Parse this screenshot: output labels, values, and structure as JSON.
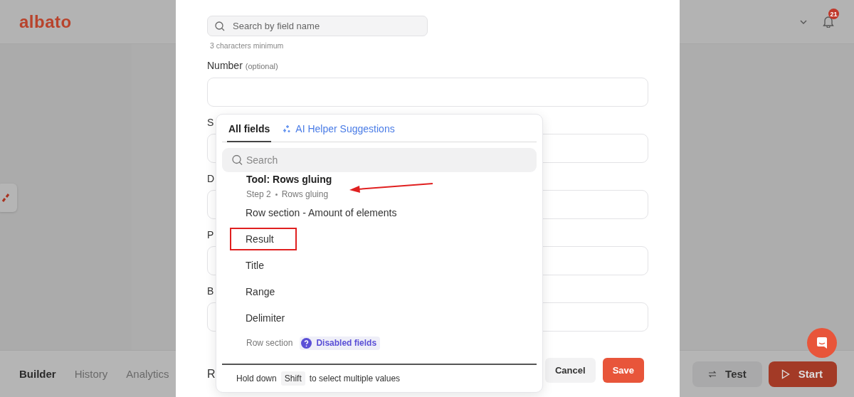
{
  "header": {
    "logo": "albato",
    "notifications": "21"
  },
  "bottom_bar": {
    "tabs": [
      {
        "label": "Builder",
        "selected": true
      },
      {
        "label": "History",
        "selected": false
      },
      {
        "label": "Analytics",
        "selected": false
      }
    ],
    "test_button": "Test",
    "start_button": "Start"
  },
  "modal": {
    "search": {
      "placeholder": "Search by field name",
      "hint": "3 characters minimum"
    },
    "fields": [
      {
        "label": "Number",
        "note": "(optional)"
      },
      {
        "label": "S"
      },
      {
        "label": "D"
      },
      {
        "label": "P"
      },
      {
        "label": "B"
      }
    ],
    "section_heading": "R",
    "cancel_button": "Cancel",
    "save_button": "Save"
  },
  "dropdown": {
    "tabs": [
      {
        "label": "All fields",
        "selected": true,
        "kind": "plain"
      },
      {
        "label": "AI Helper Suggestions",
        "selected": false,
        "kind": "ai"
      }
    ],
    "search": {
      "placeholder": "Search"
    },
    "group": {
      "title": "Tool: Rows gluing",
      "step": "Step 2",
      "step_name": "Rows gluing"
    },
    "items": [
      {
        "label": "Row section - Amount of elements",
        "highlighted": false
      },
      {
        "label": "Result",
        "highlighted": true
      },
      {
        "label": "Title",
        "highlighted": false
      },
      {
        "label": "Range",
        "highlighted": false
      },
      {
        "label": "Delimiter",
        "highlighted": false
      }
    ],
    "disabled_row": {
      "label": "Row section",
      "badge": "Disabled fields"
    },
    "footer": {
      "before": "Hold down",
      "key": "Shift",
      "after": "to select multiple values"
    }
  }
}
